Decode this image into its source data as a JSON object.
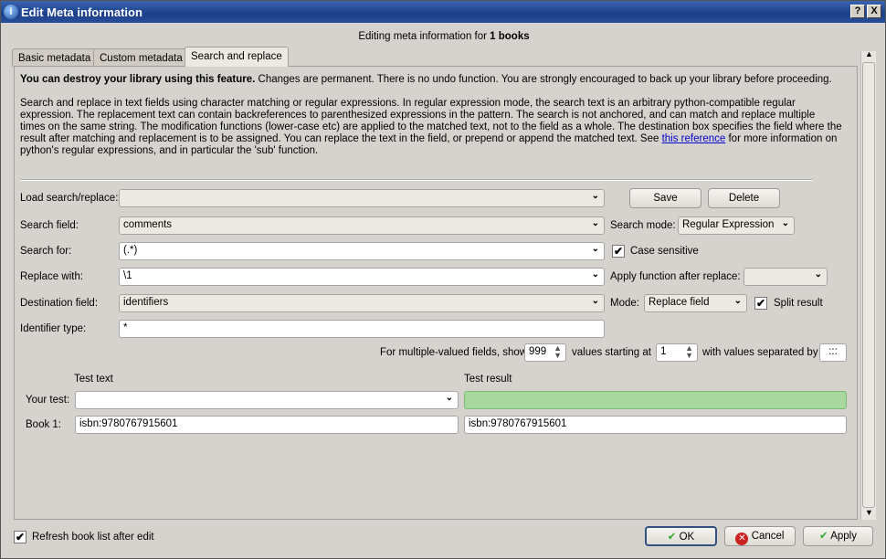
{
  "window": {
    "title": "Edit Meta information",
    "help_button": "?",
    "close_button": "X"
  },
  "heading": {
    "prefix": "Editing meta information for ",
    "count": "1 books"
  },
  "tabs": [
    {
      "label": "Basic metadata"
    },
    {
      "label": "Custom metadata"
    },
    {
      "label": "Search and replace",
      "active": true
    }
  ],
  "warning": {
    "bold": "You can destroy your library using this feature.",
    "text": " Changes are permanent. There is no undo function. You are strongly encouraged to back up your library before proceeding."
  },
  "description": {
    "text": "Search and replace in text fields using character matching or regular expressions. In regular expression mode, the search text is an arbitrary python-compatible regular expression. The replacement text can contain backreferences to parenthesized expressions in the pattern. The search is not anchored, and can match and replace multiple times on the same string. The modification functions (lower-case etc) are applied to the matched text, not to the field as a whole. The destination box specifies the field where the result after matching and replacement is to be assigned. You can replace the text in the field, or prepend or append the matched text. See ",
    "link": "this reference",
    "tail": " for more information on python's regular expressions, and in particular the 'sub' function."
  },
  "form": {
    "load_label": "Load search/replace:",
    "load_value": "",
    "save": "Save",
    "delete": "Delete",
    "search_field_label": "Search field:",
    "search_field_value": "comments",
    "search_mode_label": "Search mode:",
    "search_mode_value": "Regular Expression",
    "search_for_label": "Search for:",
    "search_for_value": "(.*)",
    "case_sensitive_label": "Case sensitive",
    "case_sensitive": true,
    "replace_label": "Replace with:",
    "replace_value": "\\1",
    "apply_function_label": "Apply function after replace:",
    "apply_function_value": "",
    "dest_label": "Destination field:",
    "dest_value": "identifiers",
    "mode_label": "Mode:",
    "mode_value": "Replace field",
    "split_label": "Split result",
    "split_result": true,
    "identifier_label": "Identifier type:",
    "identifier_value": "*",
    "multi_label": "For multiple-valued fields, show",
    "show_value": "999",
    "starting_label": "values starting at",
    "starting_value": "1",
    "separated_label": "with values separated by",
    "separator_value": ":::"
  },
  "test": {
    "test_text_header": "Test text",
    "test_result_header": "Test result",
    "your_test_label": "Your test:",
    "your_test_value": "",
    "your_test_result": "",
    "book_label": "Book 1:",
    "book_text": "isbn:9780767915601",
    "book_result": "isbn:9780767915601"
  },
  "footer": {
    "refresh_label": "Refresh book list after edit",
    "refresh": true,
    "ok": "OK",
    "cancel": "Cancel",
    "apply": "Apply"
  },
  "colors": {
    "titlebar": "#1c3f8a",
    "result_ok": "#a8d8a0",
    "link": "#0000cc"
  }
}
